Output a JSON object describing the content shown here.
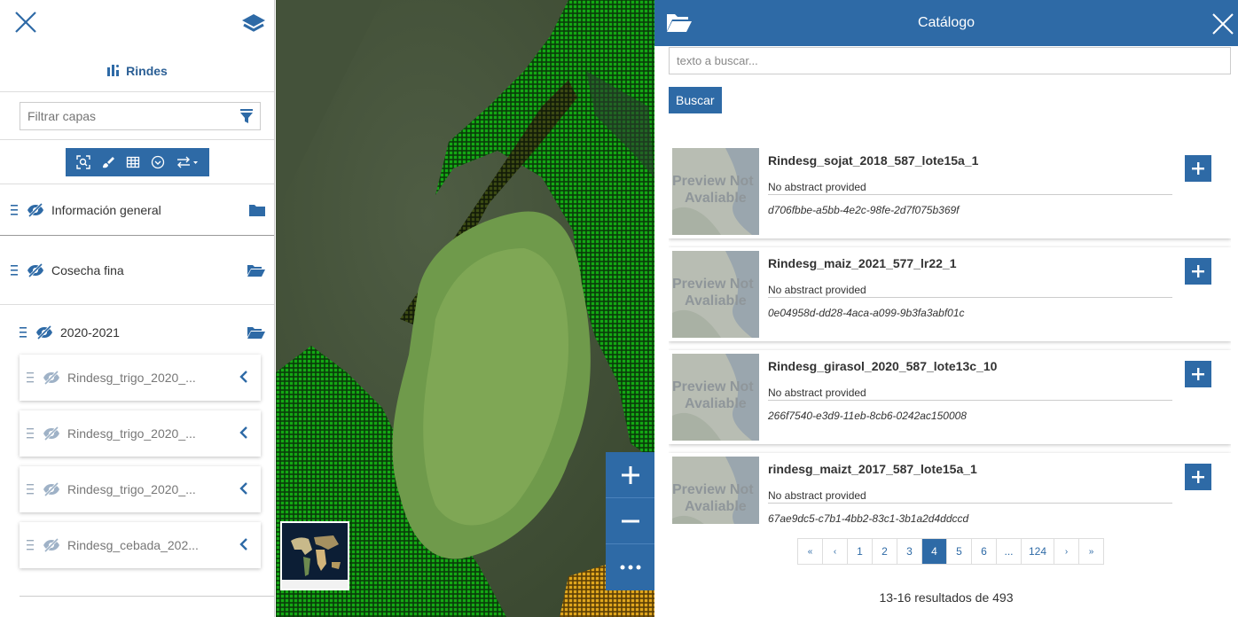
{
  "toc": {
    "title": "Rindes",
    "filter_placeholder": "Filtrar capas",
    "groups": [
      {
        "label": "Información general"
      },
      {
        "label": "Cosecha fina"
      },
      {
        "label": "2020-2021"
      }
    ],
    "layers": [
      {
        "label": "Rindesg_trigo_2020_..."
      },
      {
        "label": "Rindesg_trigo_2020_..."
      },
      {
        "label": "Rindesg_trigo_2020_..."
      },
      {
        "label": "Rindesg_cebada_202..."
      }
    ]
  },
  "map": {
    "zoom_in": "+",
    "zoom_out": "−",
    "more": "•••"
  },
  "catalog": {
    "title": "Catálogo",
    "search_placeholder": "texto a buscar...",
    "search_button": "Buscar",
    "thumb_text_line1": "Preview Not",
    "thumb_text_line2": "Avaliable",
    "records": [
      {
        "title": "Rindesg_sojat_2018_587_lote15a_1",
        "abstract": "No abstract provided",
        "uuid": "d706fbbe-a5bb-4e2c-98fe-2d7f075b369f"
      },
      {
        "title": "Rindesg_maiz_2021_577_lr22_1",
        "abstract": "No abstract provided",
        "uuid": "0e04958d-dd28-4aca-a099-9b3fa3abf01c"
      },
      {
        "title": "Rindesg_girasol_2020_587_lote13c_10",
        "abstract": "No abstract provided",
        "uuid": "266f7540-e3d9-11eb-8cb6-0242ac150008"
      },
      {
        "title": "rindesg_maizt_2017_587_lote15a_1",
        "abstract": "No abstract provided",
        "uuid": "67ae9dc5-c7b1-4bb2-83c1-3b1a2d4ddccd"
      }
    ],
    "pagination": {
      "first": "«",
      "prev": "‹",
      "pages": [
        "1",
        "2",
        "3",
        "4",
        "5",
        "6",
        "...",
        "124"
      ],
      "active": "4",
      "next": "›",
      "last": "»"
    },
    "result_count": "13-16 resultados de 493"
  },
  "colors": {
    "primary": "#2e6aa6",
    "field_green": "#0f7a0f",
    "yellow": "#d8a21a"
  }
}
